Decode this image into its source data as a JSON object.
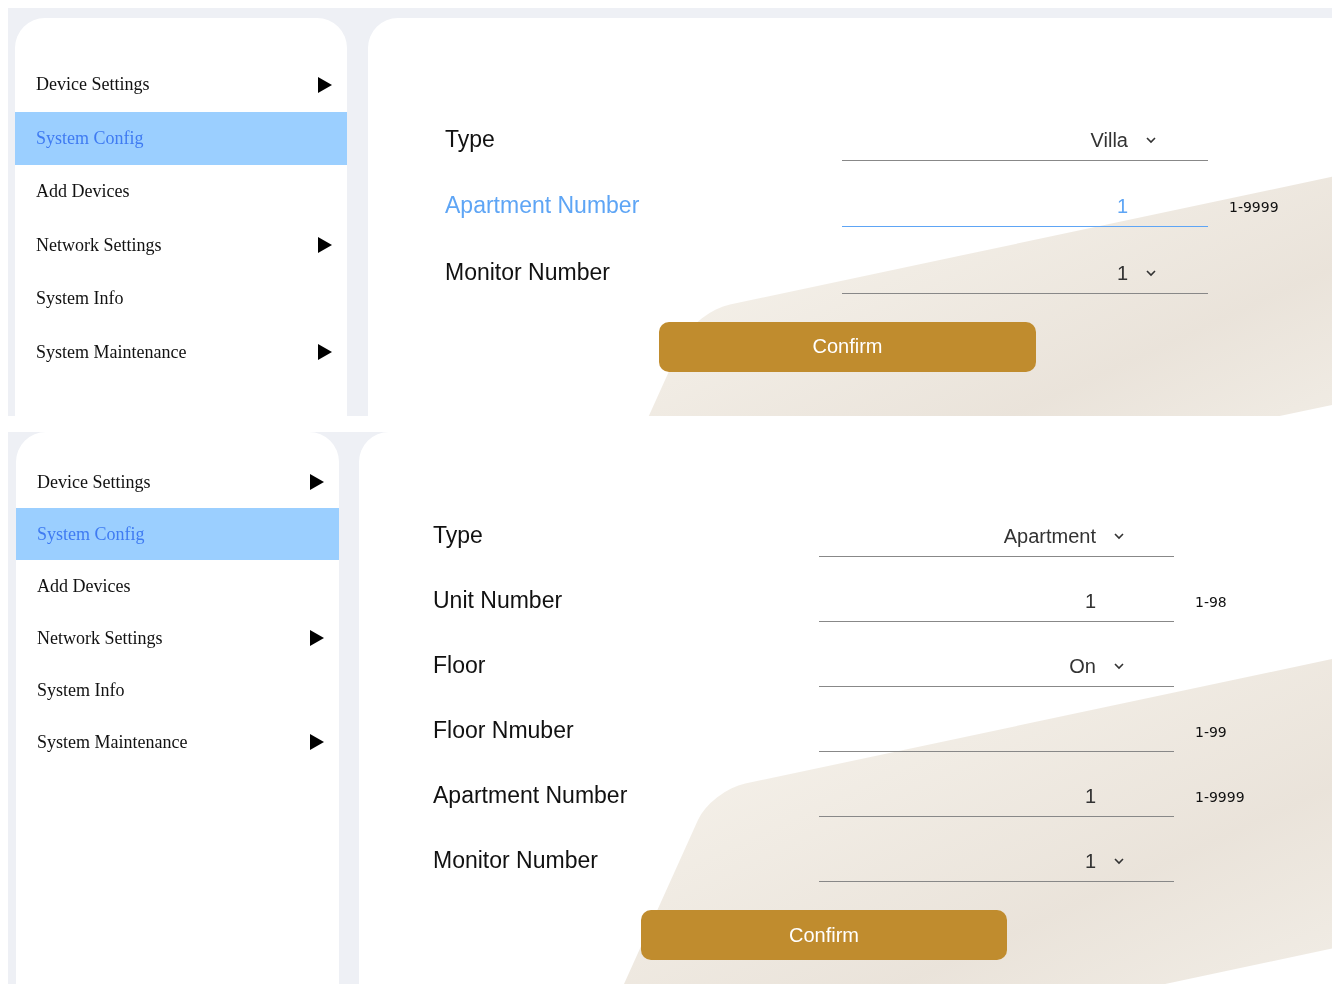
{
  "panels": [
    {
      "menu": [
        {
          "label": "Device Settings",
          "selected": false,
          "has_submenu": true
        },
        {
          "label": "System Config",
          "selected": true,
          "has_submenu": false
        },
        {
          "label": "Add Devices",
          "selected": false,
          "has_submenu": false
        },
        {
          "label": "Network Settings",
          "selected": false,
          "has_submenu": true
        },
        {
          "label": "System Info",
          "selected": false,
          "has_submenu": false
        },
        {
          "label": "System Maintenance",
          "selected": false,
          "has_submenu": true
        }
      ],
      "fields": [
        {
          "kind": "select",
          "label": "Type",
          "value": "Villa",
          "focused": false
        },
        {
          "kind": "input",
          "label": "Apartment Number",
          "value": "1",
          "hint": "1-9999",
          "focused": true
        },
        {
          "kind": "select",
          "label": "Monitor Number",
          "value": "1",
          "focused": false
        }
      ],
      "confirm": "Confirm"
    },
    {
      "menu": [
        {
          "label": "Device Settings",
          "selected": false,
          "has_submenu": true
        },
        {
          "label": "System Config",
          "selected": true,
          "has_submenu": false
        },
        {
          "label": "Add Devices",
          "selected": false,
          "has_submenu": false
        },
        {
          "label": "Network Settings",
          "selected": false,
          "has_submenu": true
        },
        {
          "label": "System Info",
          "selected": false,
          "has_submenu": false
        },
        {
          "label": "System Maintenance",
          "selected": false,
          "has_submenu": true
        }
      ],
      "fields": [
        {
          "kind": "select",
          "label": "Type",
          "value": "Apartment",
          "focused": false
        },
        {
          "kind": "input",
          "label": "Unit Number",
          "value": "1",
          "hint": "1-98",
          "focused": false
        },
        {
          "kind": "select",
          "label": "Floor",
          "value": "On",
          "focused": false
        },
        {
          "kind": "input",
          "label": "Floor Nmuber",
          "hint": "1-99",
          "focused": false
        },
        {
          "kind": "input",
          "label": "Apartment Number",
          "value": "1",
          "hint": "1-9999",
          "focused": false
        },
        {
          "kind": "select",
          "label": "Monitor Number",
          "value": "1",
          "focused": false
        }
      ],
      "confirm": "Confirm"
    }
  ]
}
